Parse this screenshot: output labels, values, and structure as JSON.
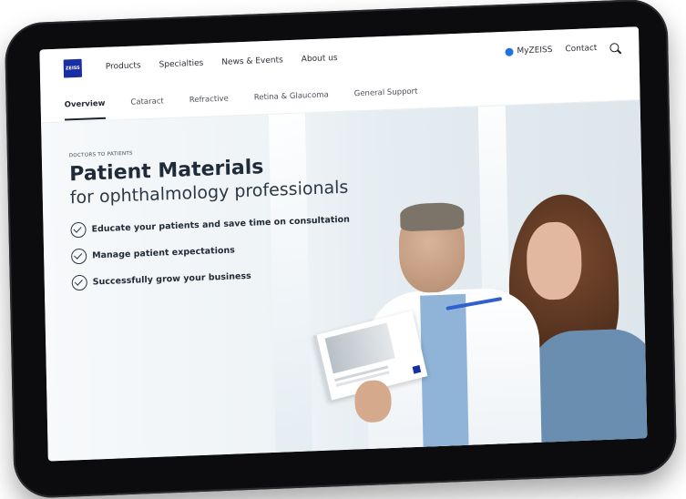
{
  "brand": {
    "logo_text": "ZEISS",
    "accent": "#1a2ea4"
  },
  "topnav": {
    "items": [
      "Products",
      "Specialties",
      "News & Events",
      "About us"
    ],
    "myzeiss": "MyZEISS",
    "contact": "Contact",
    "search_icon": "search-icon"
  },
  "subnav": {
    "items": [
      "Overview",
      "Cataract",
      "Refractive",
      "Retina & Glaucoma",
      "General Support"
    ],
    "active": "Overview"
  },
  "hero": {
    "eyebrow": "DOCTORS TO PATIENTS",
    "headline": "Patient Materials",
    "subhead": "for ophthalmology professionals",
    "bullets": [
      "Educate your patients and save time on consultation",
      "Manage patient expectations",
      "Successfully grow your business"
    ]
  },
  "colors": {
    "dark_text": "#1f2b38",
    "tablet_bezel": "#0c0c0e",
    "link_blue": "#1e73e0"
  }
}
